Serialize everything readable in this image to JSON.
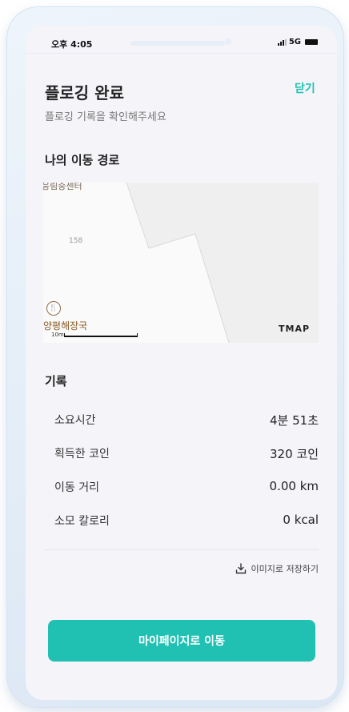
{
  "status_bar": {
    "time": "오후 4:05",
    "network": "5G"
  },
  "header": {
    "title": "플로깅 완료",
    "close_label": "닫기",
    "subtitle": "플로깅 기록을 확인해주세요"
  },
  "route": {
    "section_title": "나의 이동 경로",
    "map": {
      "road_label": "응림중센터",
      "lot_number": "158",
      "poi_label": "양평해장국",
      "scale_label": "10m",
      "provider": "TMAP"
    }
  },
  "record": {
    "section_title": "기록",
    "rows": [
      {
        "label": "소요시간",
        "value": "4분 51초"
      },
      {
        "label": "획득한 코인",
        "value": "320 코인"
      },
      {
        "label": "이동 거리",
        "value": "0.00 km"
      },
      {
        "label": "소모 칼로리",
        "value": "0 kcal"
      }
    ]
  },
  "actions": {
    "save_image_label": "이미지로 저장하기",
    "mypage_button_label": "마이페이지로 이동"
  },
  "colors": {
    "accent": "#20c1b2",
    "close_text": "#21c2b3"
  }
}
